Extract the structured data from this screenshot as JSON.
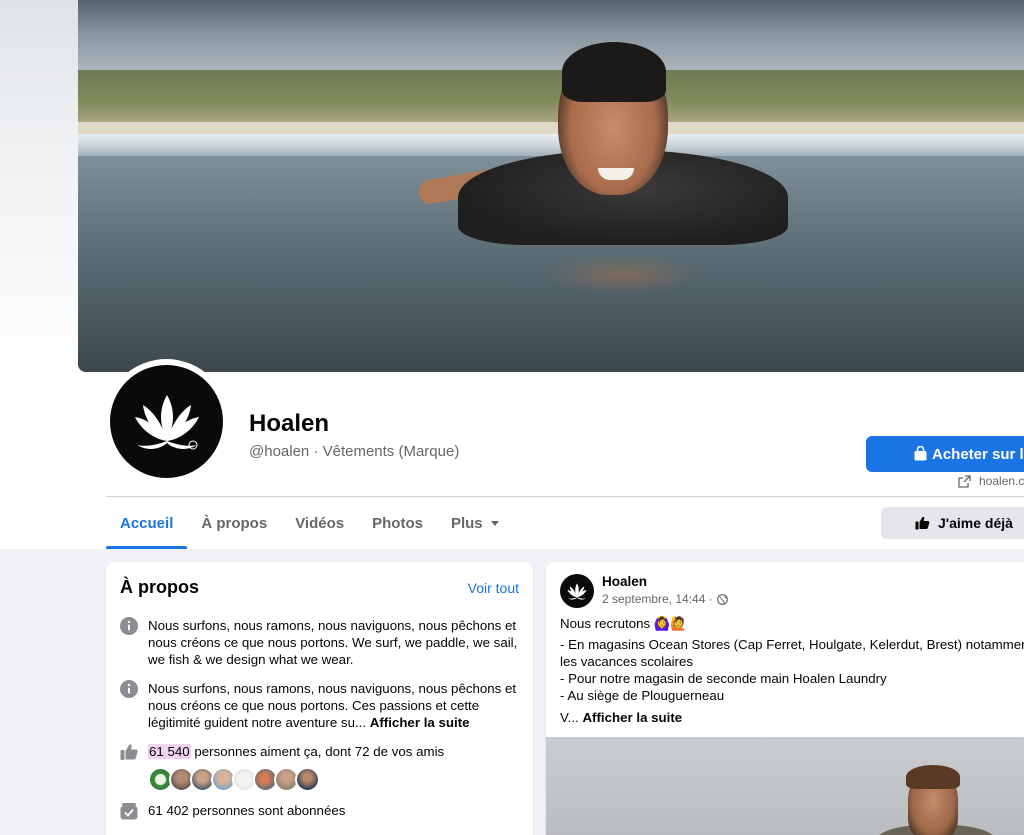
{
  "page": {
    "name": "Hoalen",
    "handle": "@hoalen · Vêtements (Marque)",
    "shop_button": "Acheter sur le",
    "website": "hoalen.c",
    "like_button": "J'aime déjà"
  },
  "tabs": [
    {
      "label": "Accueil",
      "active": true
    },
    {
      "label": "À propos",
      "active": false
    },
    {
      "label": "Vidéos",
      "active": false
    },
    {
      "label": "Photos",
      "active": false
    },
    {
      "label": "Plus",
      "active": false
    }
  ],
  "about": {
    "title": "À propos",
    "see_all": "Voir tout",
    "description_1": "Nous surfons, nous ramons, nous naviguons, nous pêchons et nous créons ce que nous portons. We surf, we paddle, we sail, we fish & we design what we wear.",
    "description_2": "Nous surfons, nous ramons, nous naviguons, nous pêchons et nous créons ce que nous portons. Ces passions et cette légitimité guident notre aventure su...",
    "see_more": "Afficher la suite",
    "likes_count": "61 540",
    "likes_text": " personnes aiment ça, dont 72 de vos amis",
    "followers_text": "61 402 personnes sont abonnées"
  },
  "post": {
    "author": "Hoalen",
    "date": "2 septembre, 14:44 ·",
    "emojis": "🙆‍♀️🙋",
    "line_1": "Nous recrutons ",
    "line_2": "- En magasins Ocean Stores (Cap Ferret, Houlgate, Kelerdut, Brest) notammen",
    "line_3": "les vacances scolaires",
    "line_4": "- Pour notre magasin de seconde main Hoalen Laundry",
    "line_5": "- Au siège de Plouguerneau",
    "line_6": "V... ",
    "see_more": "Afficher la suite"
  },
  "colors": {
    "accent": "#1b74e4",
    "text_secondary": "#65676b",
    "highlight": "#f2d3ef"
  },
  "icons": {
    "info": "info-circle-icon",
    "like": "thumbs-up-icon",
    "followers": "follow-check-icon",
    "globe": "globe-icon",
    "bag": "shopping-bag-icon",
    "external": "external-link-icon"
  }
}
